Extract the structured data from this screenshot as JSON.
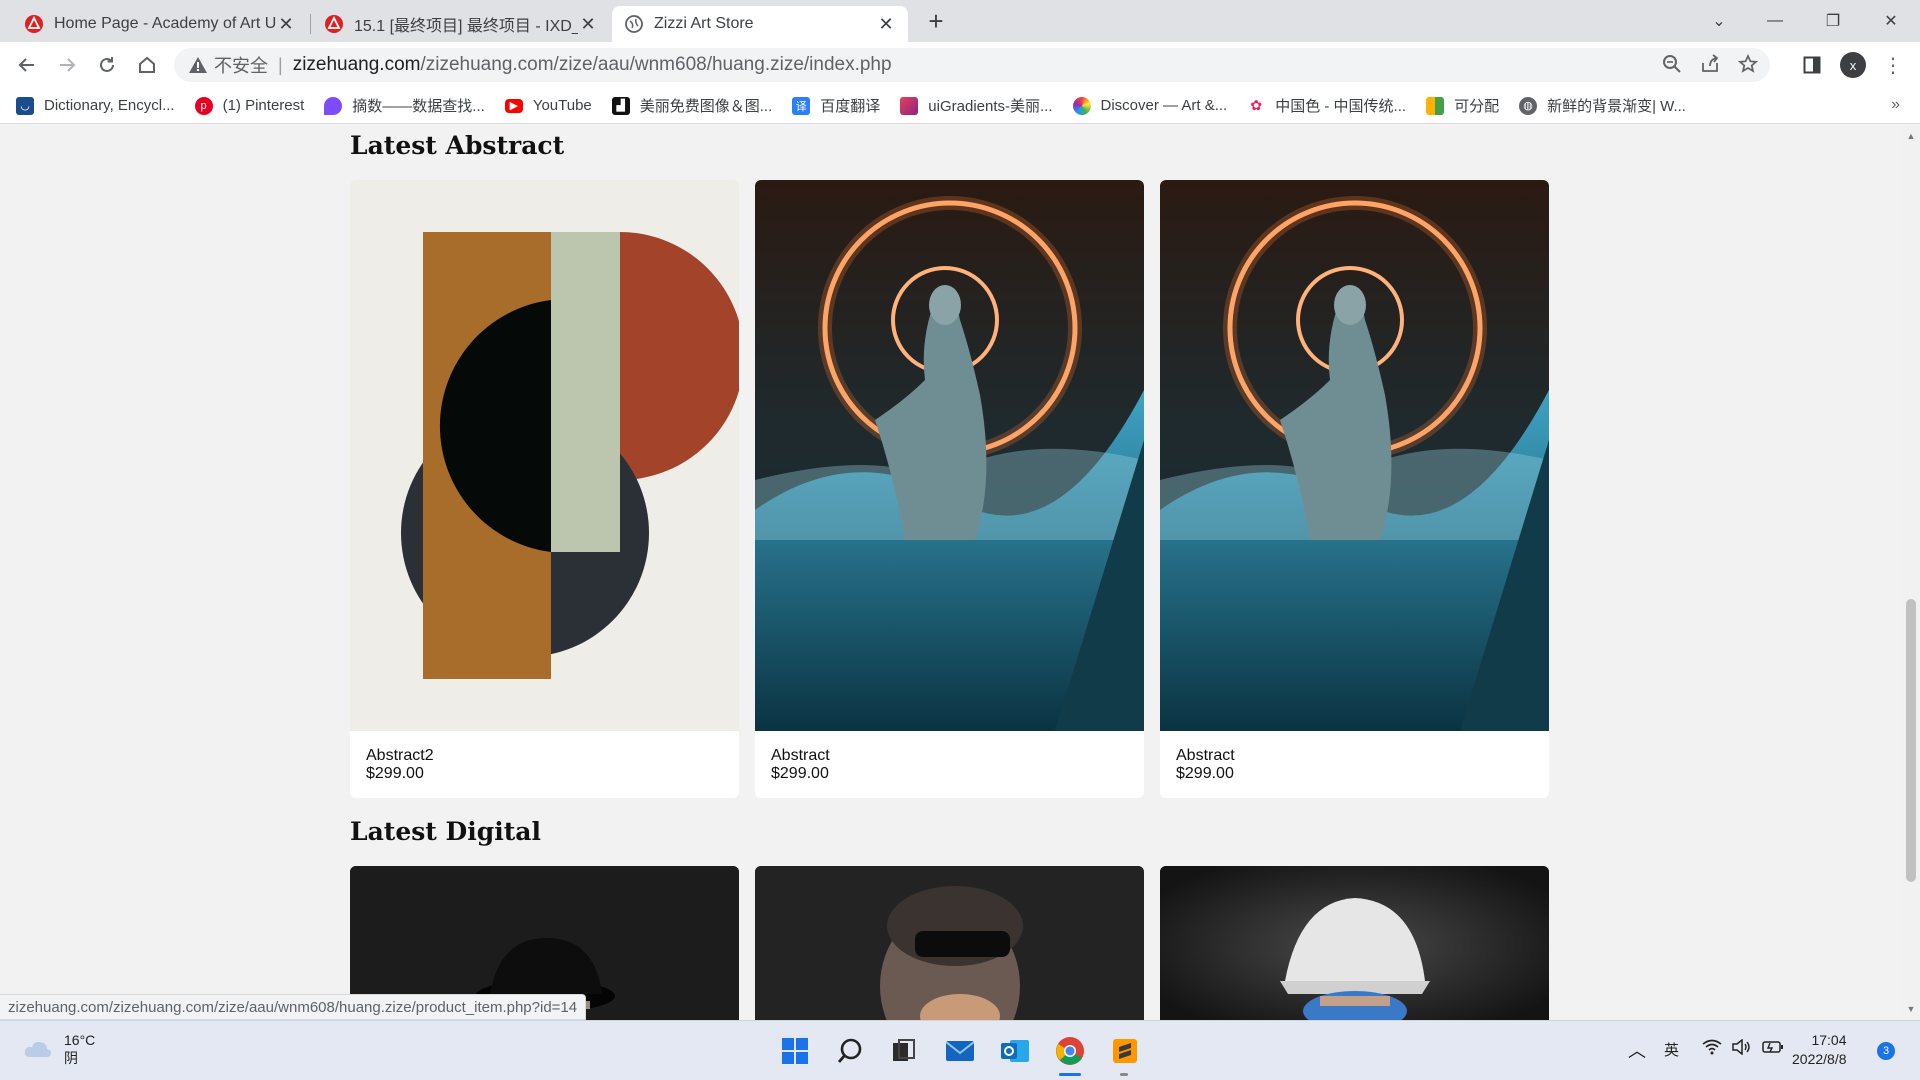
{
  "tabs": [
    {
      "title": "Home Page - Academy of Art U",
      "active": false
    },
    {
      "title": "15.1 [最终项目] 最终项目 - IXD_",
      "active": false
    },
    {
      "title": "Zizzi Art Store",
      "active": true
    }
  ],
  "window_controls": {
    "minimize": "—",
    "restore": "❐",
    "close": "✕"
  },
  "address": {
    "insecure_label": "不安全",
    "host": "zizehuang.com",
    "path": "/zizehuang.com/zize/aau/wnm608/huang.zize/index.php"
  },
  "profile_initial": "x",
  "bookmarks": [
    {
      "label": "Dictionary, Encycl...",
      "icon": "dictionary-icon",
      "color": "#1a4e8a"
    },
    {
      "label": "(1) Pinterest",
      "icon": "pinterest-icon",
      "color": "#e60023"
    },
    {
      "label": "摘数——数据查找...",
      "icon": "drop-icon",
      "color": "#7c4dff"
    },
    {
      "label": "YouTube",
      "icon": "youtube-icon",
      "color": "#ff0000"
    },
    {
      "label": "美丽免费图像＆图...",
      "icon": "unsplash-icon",
      "color": "#111111"
    },
    {
      "label": "百度翻译",
      "icon": "baidu-translate-icon",
      "color": "#2d7ff9"
    },
    {
      "label": "uiGradients-美丽...",
      "icon": "gradient-icon",
      "color": "#b33791"
    },
    {
      "label": "Discover — Art &...",
      "icon": "color-wheel-icon",
      "color": "#ff9800"
    },
    {
      "label": "中国色 - 中国传统...",
      "icon": "flower-icon",
      "color": "#e91e63"
    },
    {
      "label": "可分配",
      "icon": "palette-icon",
      "color": "#ffb300"
    },
    {
      "label": "新鲜的背景渐变| W...",
      "icon": "globe-icon",
      "color": "#5f6368"
    }
  ],
  "sections": {
    "abstract": {
      "title": "Latest Abstract",
      "products": [
        {
          "name": "Abstract2",
          "price": "$299.00"
        },
        {
          "name": "Abstract",
          "price": "$299.00"
        },
        {
          "name": "Abstract",
          "price": "$299.00"
        }
      ]
    },
    "digital": {
      "title": "Latest Digital"
    }
  },
  "status_url": "zizehuang.com/zizehuang.com/zize/aau/wnm608/huang.zize/product_item.php?id=14",
  "taskbar": {
    "temperature": "16°C",
    "weather": "阴",
    "ime": "英",
    "time": "17:04",
    "date": "2022/8/8",
    "notifications": "3"
  }
}
